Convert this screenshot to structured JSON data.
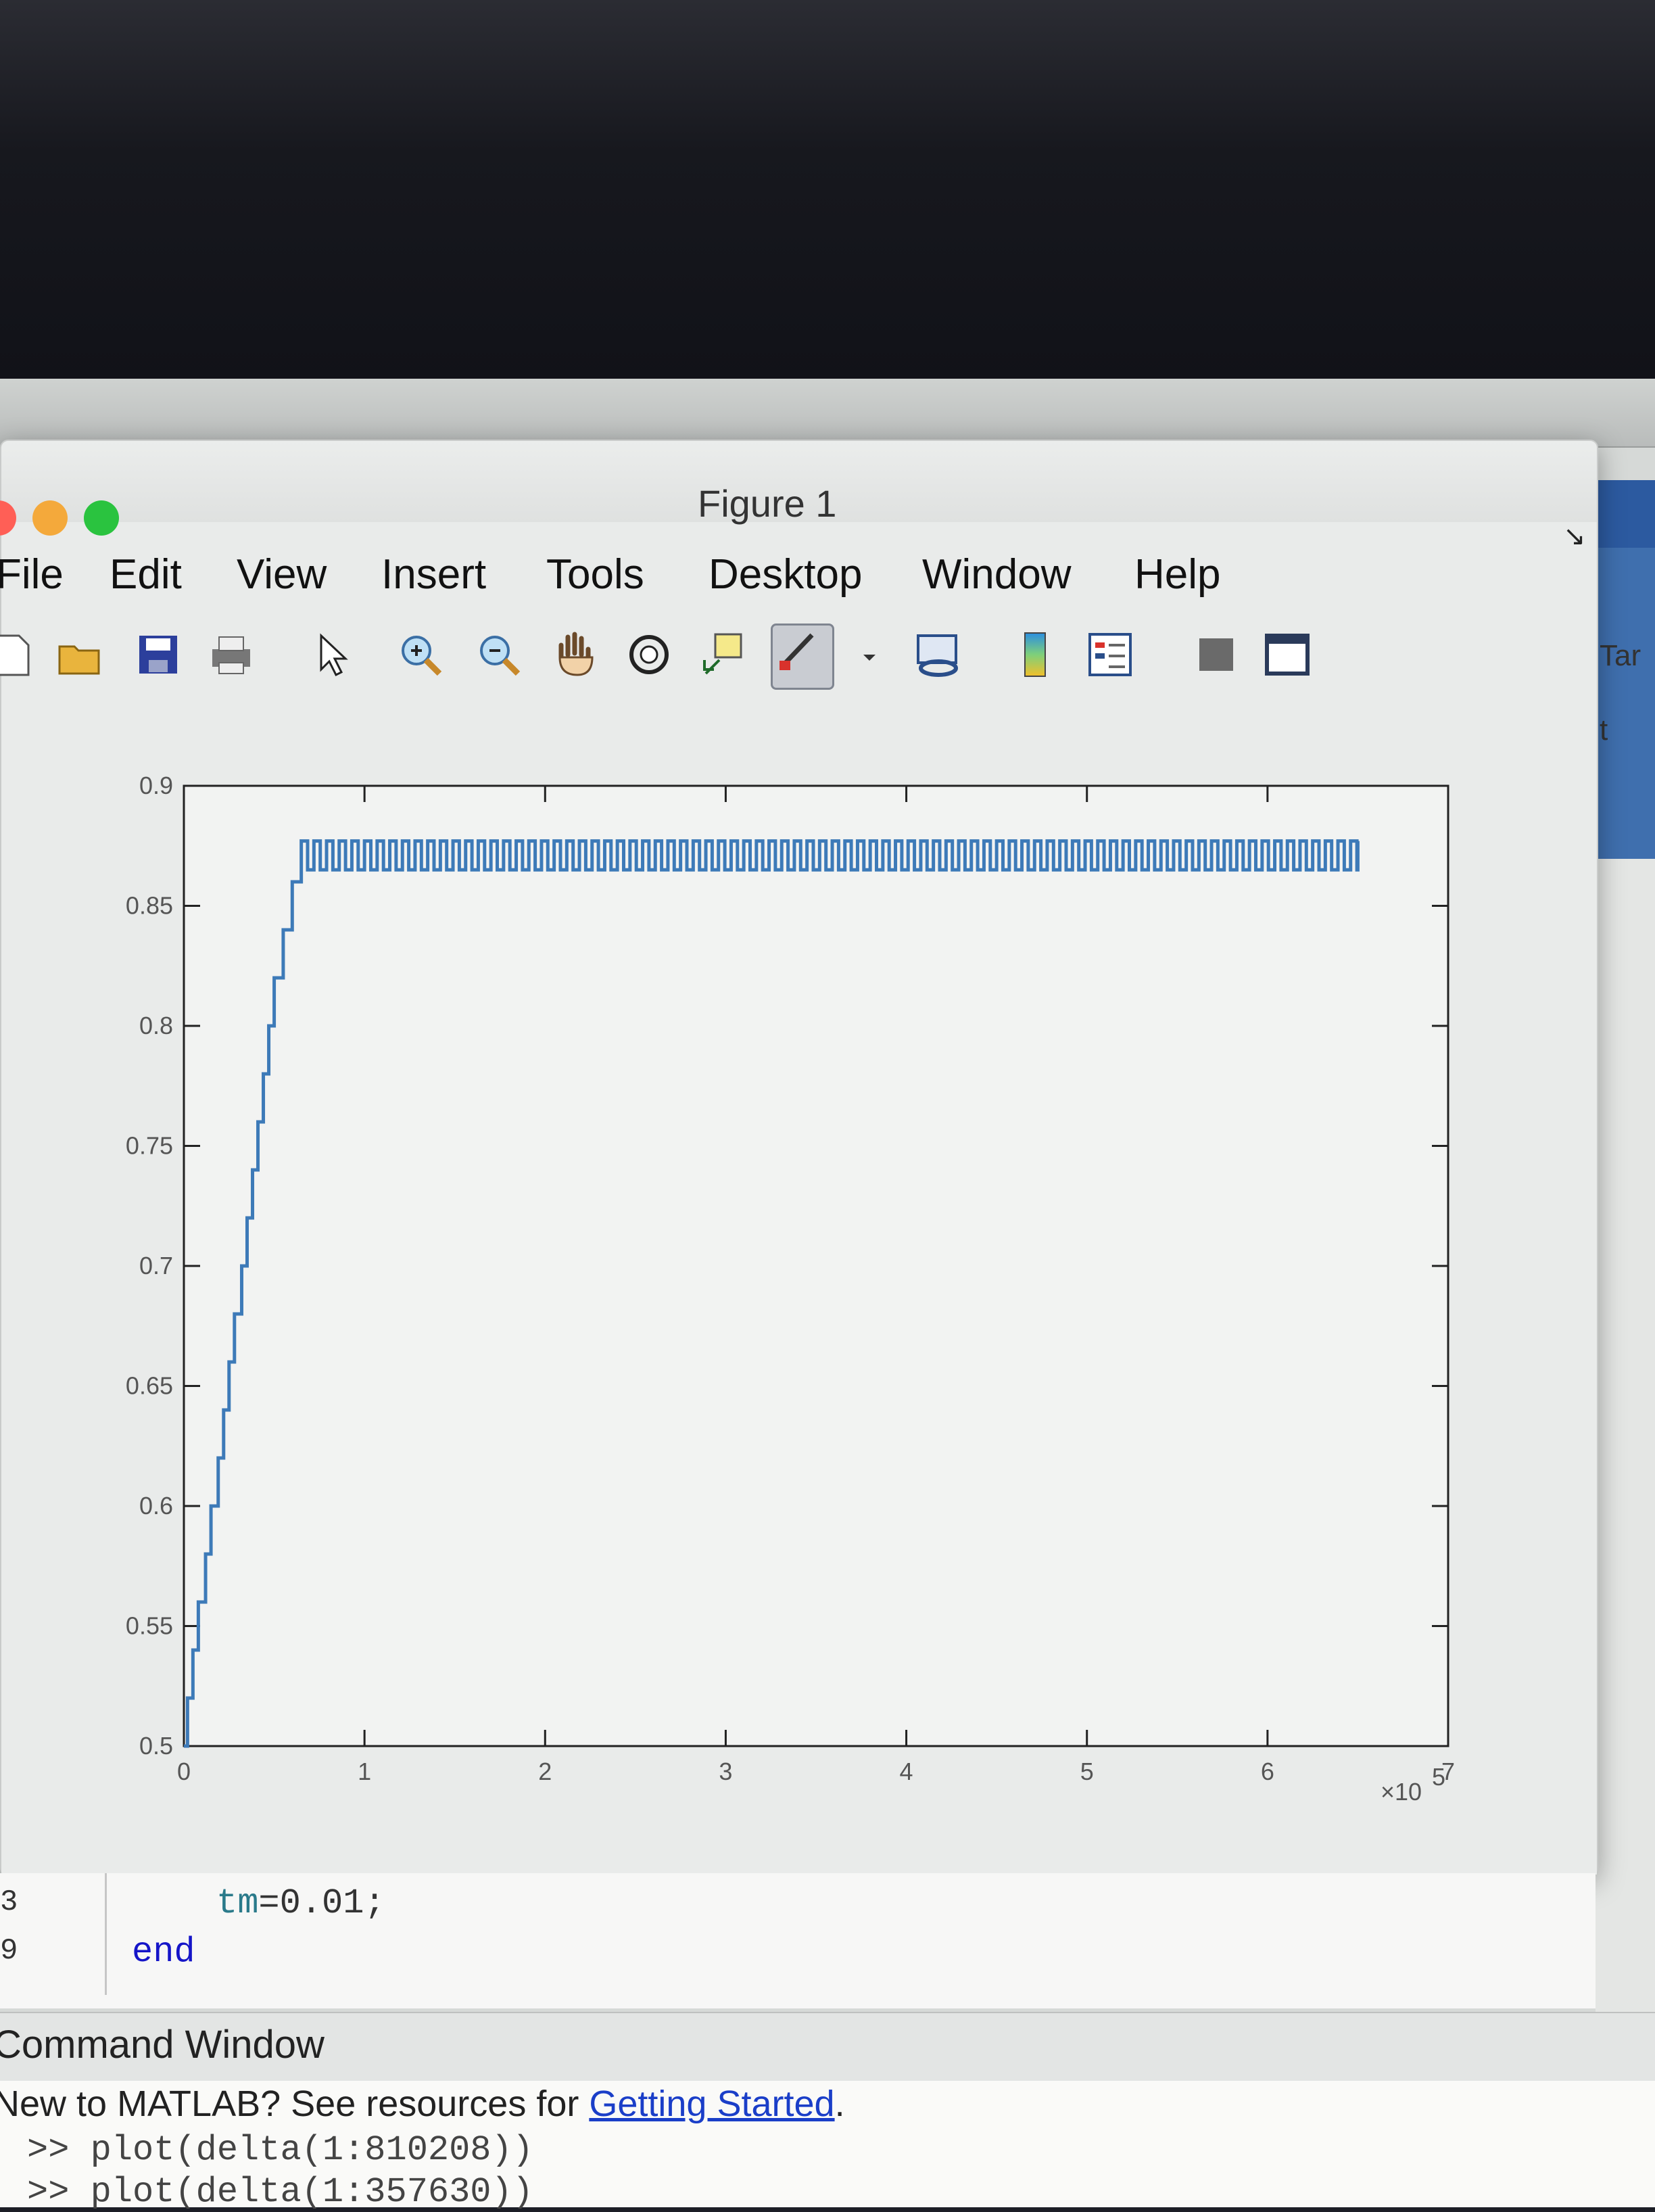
{
  "figure": {
    "title": "Figure 1",
    "menu": [
      "File",
      "Edit",
      "View",
      "Insert",
      "Tools",
      "Desktop",
      "Window",
      "Help"
    ],
    "toolbar_icons": [
      "new-figure-icon",
      "open-file-icon",
      "save-icon",
      "print-icon",
      "pointer-icon",
      "zoom-in-icon",
      "zoom-out-icon",
      "pan-hand-icon",
      "rotate-3d-icon",
      "data-cursor-icon",
      "brush-icon",
      "brush-dropdown-icon",
      "link-plot-icon",
      "colorbar-icon",
      "legend-icon",
      "hide-plot-tools-icon",
      "show-plot-tools-icon"
    ]
  },
  "side": {
    "label1": "Tar",
    "label2": "t"
  },
  "chart_data": {
    "type": "line",
    "xlim": [
      0,
      7
    ],
    "ylim": [
      0.5,
      0.9
    ],
    "x_ticks": [
      "0",
      "1",
      "2",
      "3",
      "4",
      "5",
      "6",
      "7"
    ],
    "y_ticks": [
      "0.5",
      "0.55",
      "0.6",
      "0.65",
      "0.7",
      "0.75",
      "0.8",
      "0.85",
      "0.9"
    ],
    "x_multiplier": "×10",
    "x_multiplier_exponent": "5",
    "line_color": "#3d7ab8",
    "ramp": [
      [
        0.0,
        0.5
      ],
      [
        0.02,
        0.52
      ],
      [
        0.05,
        0.54
      ],
      [
        0.08,
        0.56
      ],
      [
        0.12,
        0.58
      ],
      [
        0.15,
        0.6
      ],
      [
        0.19,
        0.62
      ],
      [
        0.22,
        0.64
      ],
      [
        0.25,
        0.66
      ],
      [
        0.28,
        0.68
      ],
      [
        0.32,
        0.7
      ],
      [
        0.35,
        0.72
      ],
      [
        0.38,
        0.74
      ],
      [
        0.41,
        0.76
      ],
      [
        0.44,
        0.78
      ],
      [
        0.47,
        0.8
      ],
      [
        0.5,
        0.82
      ],
      [
        0.55,
        0.84
      ],
      [
        0.6,
        0.86
      ],
      [
        0.65,
        0.875
      ]
    ],
    "plateau": {
      "x_start": 0.65,
      "x_end": 6.5,
      "low": 0.865,
      "high": 0.877
    }
  },
  "editor": {
    "line1_var": "tm",
    "line1_rest": "=0.01;",
    "line2": "end",
    "line_numbers": [
      "3",
      "9"
    ]
  },
  "command_window": {
    "title": "Command Window",
    "new_text": "New to MATLAB? See resources for ",
    "link": "Getting Started",
    "link_after": ".",
    "lines": [
      ">> plot(delta(1:810208))",
      ">> plot(delta(1:357630))"
    ]
  }
}
